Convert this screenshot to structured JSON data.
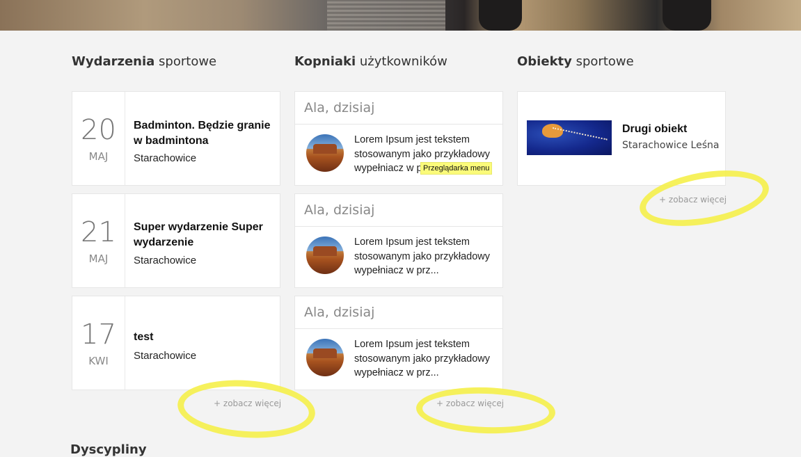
{
  "columns": {
    "events": {
      "title_bold": "Wydarzenia",
      "title_rest": "sportowe"
    },
    "users": {
      "title_bold": "Kopniaki",
      "title_rest": "użytkowników"
    },
    "objects": {
      "title_bold": "Obiekty",
      "title_rest": "sportowe"
    }
  },
  "events": [
    {
      "day": "20",
      "month": "MAJ",
      "title": "Badminton. Będzie granie w badmintona",
      "place": "Starachowice"
    },
    {
      "day": "21",
      "month": "MAJ",
      "title": "Super wydarzenie Super wydarzenie",
      "place": "Starachowice"
    },
    {
      "day": "17",
      "month": "KWI",
      "title": "test",
      "place": "Starachowice"
    }
  ],
  "kopniaki": [
    {
      "header": "Ala, dzisiaj",
      "text": "Lorem Ipsum jest tekstem stosowanym jako przykładowy wypełniacz w p"
    },
    {
      "header": "Ala, dzisiaj",
      "text": "Lorem Ipsum jest tekstem stosowanym jako przykładowy wypełniacz w prz..."
    },
    {
      "header": "Ala, dzisiaj",
      "text": "Lorem Ipsum jest tekstem stosowanym jako przykładowy wypełniacz w prz..."
    }
  ],
  "tooltip": "Przeglądarka menu",
  "objects": [
    {
      "title": "Drugi obiekt",
      "place": "Starachowice Leśna"
    }
  ],
  "more_label": "zobacz więcej",
  "more_icon": "+",
  "disciplines_title": "Dyscypliny",
  "colors": {
    "highlight": "#f5f04a",
    "background": "#f3f3f3"
  }
}
